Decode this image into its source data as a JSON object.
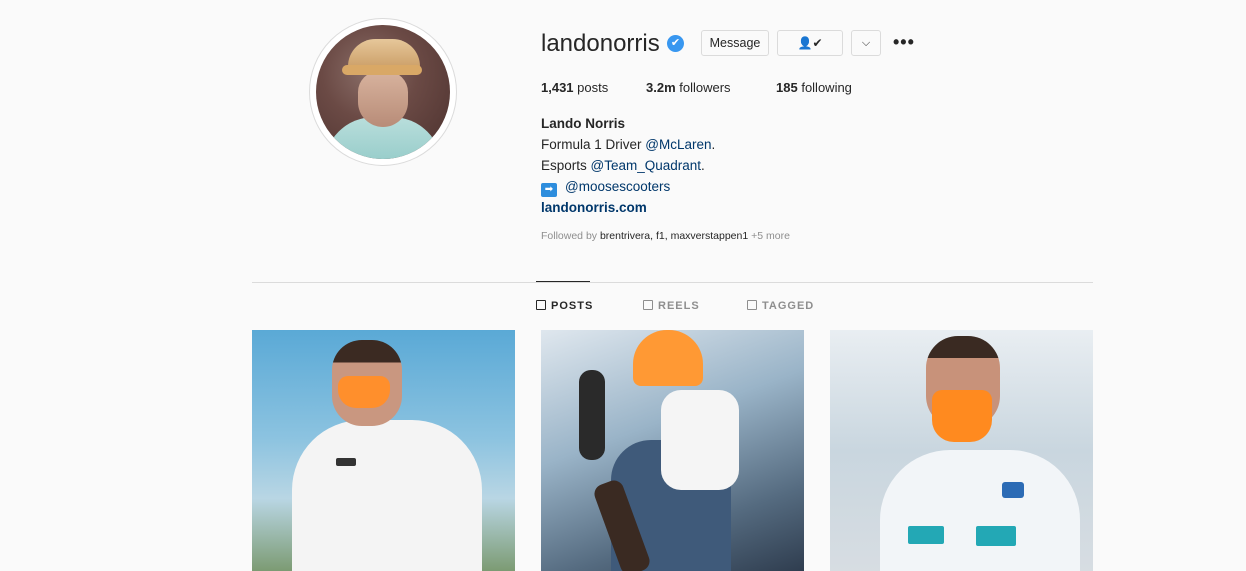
{
  "profile": {
    "username": "landonorris",
    "verified_badge": "✔",
    "buttons": {
      "message": "Message",
      "following_icon": "person-check-icon",
      "following_label": "👤✔",
      "dropdown_label": "⌵",
      "more_label": "•••"
    },
    "stats": {
      "posts_count": "1,431",
      "posts_label": "posts",
      "followers_count": "3.2m",
      "followers_label": "followers",
      "following_count": "185",
      "following_label": "following"
    },
    "bio": {
      "full_name": "Lando Norris",
      "line1_prefix": "Formula 1 Driver ",
      "line1_mention": "@McLaren",
      "line1_suffix": ".",
      "line2_prefix": "Esports ",
      "line2_mention": "@Team_Quadrant",
      "line2_suffix": ".",
      "line3_emoji": "➡",
      "line3_mention": "@moosescooters",
      "website": "landonorris.com",
      "followed_by_prefix": "Followed by ",
      "followed_by_names": "brentrivera, f1, maxverstappen1",
      "followed_by_more": " +5 more"
    }
  },
  "tabs": [
    {
      "label": "POSTS",
      "icon": "grid-icon",
      "active": true
    },
    {
      "label": "REELS",
      "icon": "reels-icon",
      "active": false
    },
    {
      "label": "TAGGED",
      "icon": "tagged-icon",
      "active": false
    }
  ],
  "colors": {
    "background": "#fafafa",
    "link": "#00376b",
    "verified": "#3897f0",
    "muted": "#8e8e8e"
  }
}
